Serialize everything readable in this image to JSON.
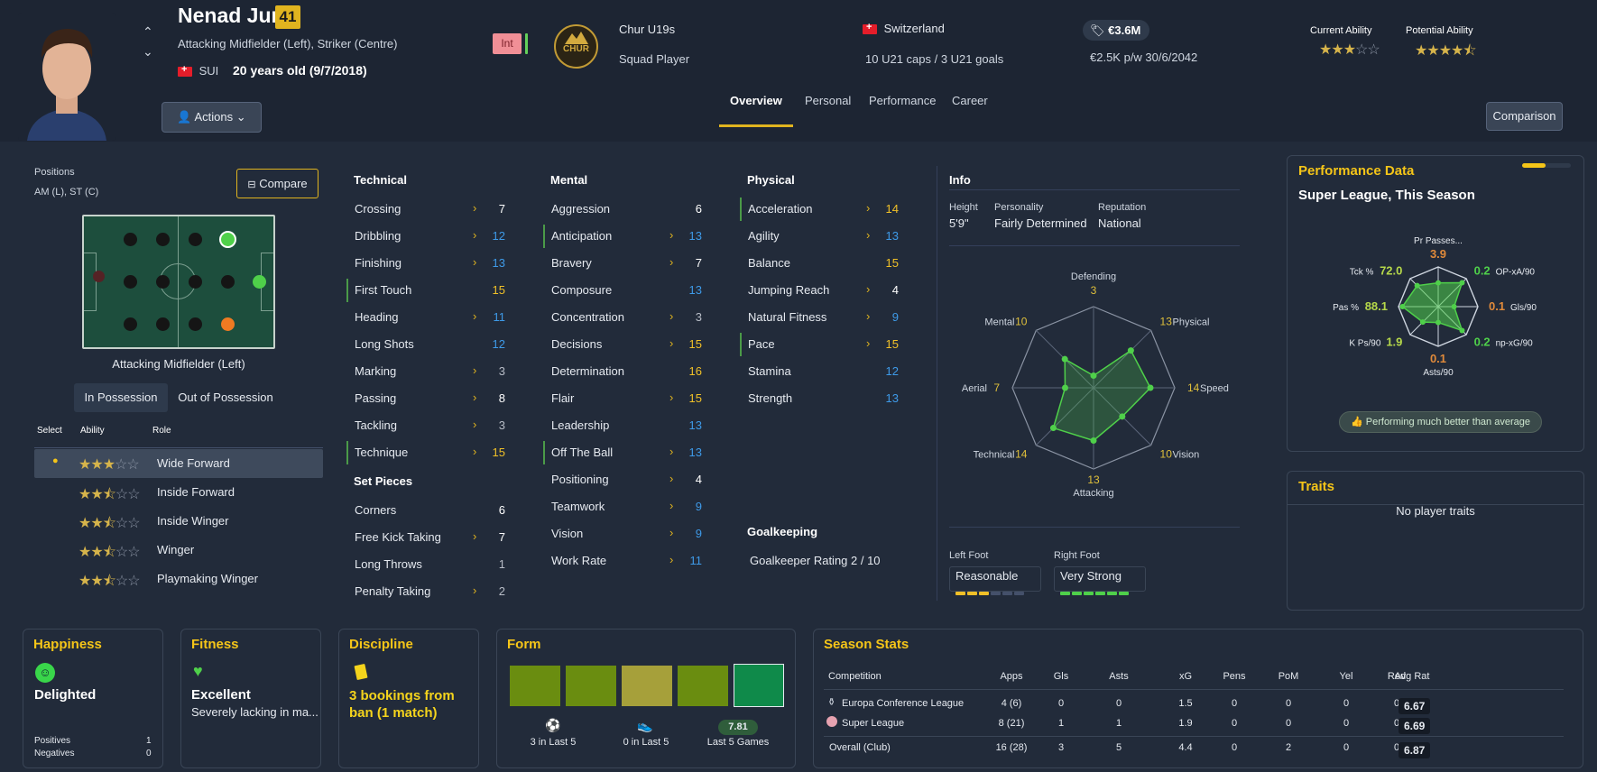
{
  "player": {
    "name": "Nenad Jurić",
    "ca_badge": "41",
    "positions_desc": "Attacking Midfielder (Left), Striker (Centre)",
    "nation": "SUI",
    "age": "20 years old (9/7/2018)",
    "int_badge": "Int"
  },
  "club": {
    "logo_text": "CHUR",
    "name": "Chur U19s",
    "status": "Squad Player"
  },
  "country": {
    "name": "Switzerland",
    "caps": "10 U21 caps / 3 U21 goals"
  },
  "contract": {
    "value": "€3.6M",
    "wage": "€2.5K p/w 30/6/2042"
  },
  "ability": {
    "current_label": "Current Ability",
    "current_stars": 3,
    "potential_label": "Potential Ability",
    "potential_stars": 4.5
  },
  "actions_label": "Actions",
  "comparison_label": "Comparison",
  "tabs": [
    "Overview",
    "Personal",
    "Performance",
    "Career"
  ],
  "positions": {
    "title": "Positions",
    "value": "AM (L), ST (C)",
    "compare_label": "Compare",
    "selected_label": "Attacking Midfielder (Left)",
    "possession_tabs": [
      "In Possession",
      "Out of Possession"
    ],
    "role_headers": [
      "Select",
      "Ability",
      "Role"
    ],
    "roles": [
      {
        "name": "Wide Forward",
        "stars": 3,
        "selected": true
      },
      {
        "name": "Inside Forward",
        "stars": 2.5
      },
      {
        "name": "Inside Winger",
        "stars": 2.5
      },
      {
        "name": "Winger",
        "stars": 2.5
      },
      {
        "name": "Playmaking Winger",
        "stars": 2.5
      }
    ]
  },
  "technical": {
    "title": "Technical",
    "attrs": [
      {
        "name": "Crossing",
        "value": "7",
        "color": "white",
        "arrow": true
      },
      {
        "name": "Dribbling",
        "value": "12",
        "color": "blue",
        "arrow": true
      },
      {
        "name": "Finishing",
        "value": "13",
        "color": "blue",
        "arrow": true
      },
      {
        "name": "First Touch",
        "value": "15",
        "color": "yellow",
        "key": true
      },
      {
        "name": "Heading",
        "value": "11",
        "color": "blue",
        "arrow": true
      },
      {
        "name": "Long Shots",
        "value": "12",
        "color": "blue"
      },
      {
        "name": "Marking",
        "value": "3",
        "color": "grey",
        "arrow": true
      },
      {
        "name": "Passing",
        "value": "8",
        "color": "white",
        "arrow": true
      },
      {
        "name": "Tackling",
        "value": "3",
        "color": "grey",
        "arrow": true
      },
      {
        "name": "Technique",
        "value": "15",
        "color": "yellow",
        "arrow": true,
        "key": true
      }
    ]
  },
  "set_pieces": {
    "title": "Set Pieces",
    "attrs": [
      {
        "name": "Corners",
        "value": "6",
        "color": "white"
      },
      {
        "name": "Free Kick Taking",
        "value": "7",
        "color": "white",
        "arrow": true
      },
      {
        "name": "Long Throws",
        "value": "1",
        "color": "grey"
      },
      {
        "name": "Penalty Taking",
        "value": "2",
        "color": "grey",
        "arrow": true
      }
    ]
  },
  "mental": {
    "title": "Mental",
    "attrs": [
      {
        "name": "Aggression",
        "value": "6",
        "color": "white"
      },
      {
        "name": "Anticipation",
        "value": "13",
        "color": "blue",
        "arrow": true,
        "key": true
      },
      {
        "name": "Bravery",
        "value": "7",
        "color": "white",
        "arrow": true
      },
      {
        "name": "Composure",
        "value": "13",
        "color": "blue"
      },
      {
        "name": "Concentration",
        "value": "3",
        "color": "grey",
        "arrow": true
      },
      {
        "name": "Decisions",
        "value": "15",
        "color": "yellow",
        "arrow": true
      },
      {
        "name": "Determination",
        "value": "16",
        "color": "yellow"
      },
      {
        "name": "Flair",
        "value": "15",
        "color": "yellow",
        "arrow": true
      },
      {
        "name": "Leadership",
        "value": "13",
        "color": "blue"
      },
      {
        "name": "Off The Ball",
        "value": "13",
        "color": "blue",
        "arrow": true,
        "key": true
      },
      {
        "name": "Positioning",
        "value": "4",
        "color": "white",
        "arrow": true
      },
      {
        "name": "Teamwork",
        "value": "9",
        "color": "blue",
        "arrow": true
      },
      {
        "name": "Vision",
        "value": "9",
        "color": "blue",
        "arrow": true
      },
      {
        "name": "Work Rate",
        "value": "11",
        "color": "blue",
        "arrow": true
      }
    ]
  },
  "physical": {
    "title": "Physical",
    "attrs": [
      {
        "name": "Acceleration",
        "value": "14",
        "color": "yellow",
        "arrow": true,
        "key": true
      },
      {
        "name": "Agility",
        "value": "13",
        "color": "blue",
        "arrow": true
      },
      {
        "name": "Balance",
        "value": "15",
        "color": "yellow"
      },
      {
        "name": "Jumping Reach",
        "value": "4",
        "color": "white",
        "arrow": true
      },
      {
        "name": "Natural Fitness",
        "value": "9",
        "color": "blue",
        "arrow": true
      },
      {
        "name": "Pace",
        "value": "15",
        "color": "yellow",
        "arrow": true,
        "key": true
      },
      {
        "name": "Stamina",
        "value": "12",
        "color": "blue"
      },
      {
        "name": "Strength",
        "value": "13",
        "color": "blue"
      }
    ]
  },
  "goalkeeping": {
    "title": "Goalkeeping",
    "rating": "Goalkeeper Rating 2 / 10"
  },
  "info": {
    "title": "Info",
    "height_label": "Height",
    "height": "5'9\"",
    "personality_label": "Personality",
    "personality": "Fairly Determined",
    "reputation_label": "Reputation",
    "reputation": "National",
    "left_foot_label": "Left Foot",
    "left_foot": "Reasonable",
    "left_foot_level": 3,
    "right_foot_label": "Right Foot",
    "right_foot": "Very Strong",
    "right_foot_level": 6
  },
  "radar": {
    "axes": [
      {
        "label": "Defending",
        "value": "3"
      },
      {
        "label": "Physical",
        "value": "13"
      },
      {
        "label": "Speed",
        "value": "14"
      },
      {
        "label": "Vision",
        "value": "10"
      },
      {
        "label": "Attacking",
        "value": "13"
      },
      {
        "label": "Technical",
        "value": "14"
      },
      {
        "label": "Aerial",
        "value": "7"
      },
      {
        "label": "Mental",
        "value": "10"
      }
    ],
    "values": [
      3,
      13,
      14,
      10,
      13,
      14,
      7,
      10
    ]
  },
  "performance": {
    "title": "Performance Data",
    "subtitle": "Super League, This Season",
    "axes": [
      {
        "label": "Pr Passes...",
        "value": "3.9"
      },
      {
        "label": "OP-xA/90",
        "value": "0.2"
      },
      {
        "label": "Gls/90",
        "value": "0.1"
      },
      {
        "label": "np-xG/90",
        "value": "0.2"
      },
      {
        "label": "Asts/90",
        "value": "0.1"
      },
      {
        "label": "K Ps/90",
        "value": "1.9"
      },
      {
        "label": "Pas %",
        "value": "88.1"
      },
      {
        "label": "Tck %",
        "value": "72.0"
      }
    ],
    "summary": "Performing much better than average"
  },
  "traits": {
    "title": "Traits",
    "text": "No player traits"
  },
  "happiness": {
    "title": "Happiness",
    "status": "Delighted",
    "pos_label": "Positives",
    "pos_value": "1",
    "neg_label": "Negatives",
    "neg_value": "0"
  },
  "fitness": {
    "title": "Fitness",
    "status": "Excellent",
    "note": "Severely lacking in ma..."
  },
  "discipline": {
    "title": "Discipline",
    "status": "3 bookings from ban (1 match)"
  },
  "form": {
    "title": "Form",
    "ratings_colors": [
      "#6a8d10",
      "#6a8d10",
      "#a6a03a",
      "#6a8d10",
      "#0f8a4a"
    ],
    "goals_text": "3 in Last 5",
    "assists_text": "0 in Last 5",
    "avg": "7.81",
    "avg_label": "Last 5 Games"
  },
  "season_stats": {
    "title": "Season Stats",
    "headers": [
      "Competition",
      "Apps",
      "Gls",
      "Asts",
      "xG",
      "Pens",
      "PoM",
      "Yel",
      "Red",
      "Avg Rat"
    ],
    "rows": [
      [
        "Europa Conference League",
        "4 (6)",
        "0",
        "0",
        "1.5",
        "0",
        "0",
        "0",
        "0",
        "6.67"
      ],
      [
        "Super League",
        "8 (21)",
        "1",
        "1",
        "1.9",
        "0",
        "0",
        "0",
        "0",
        "6.69"
      ],
      [
        "Overall (Club)",
        "16 (28)",
        "3",
        "5",
        "4.4",
        "0",
        "2",
        "0",
        "0",
        "6.87"
      ]
    ]
  }
}
